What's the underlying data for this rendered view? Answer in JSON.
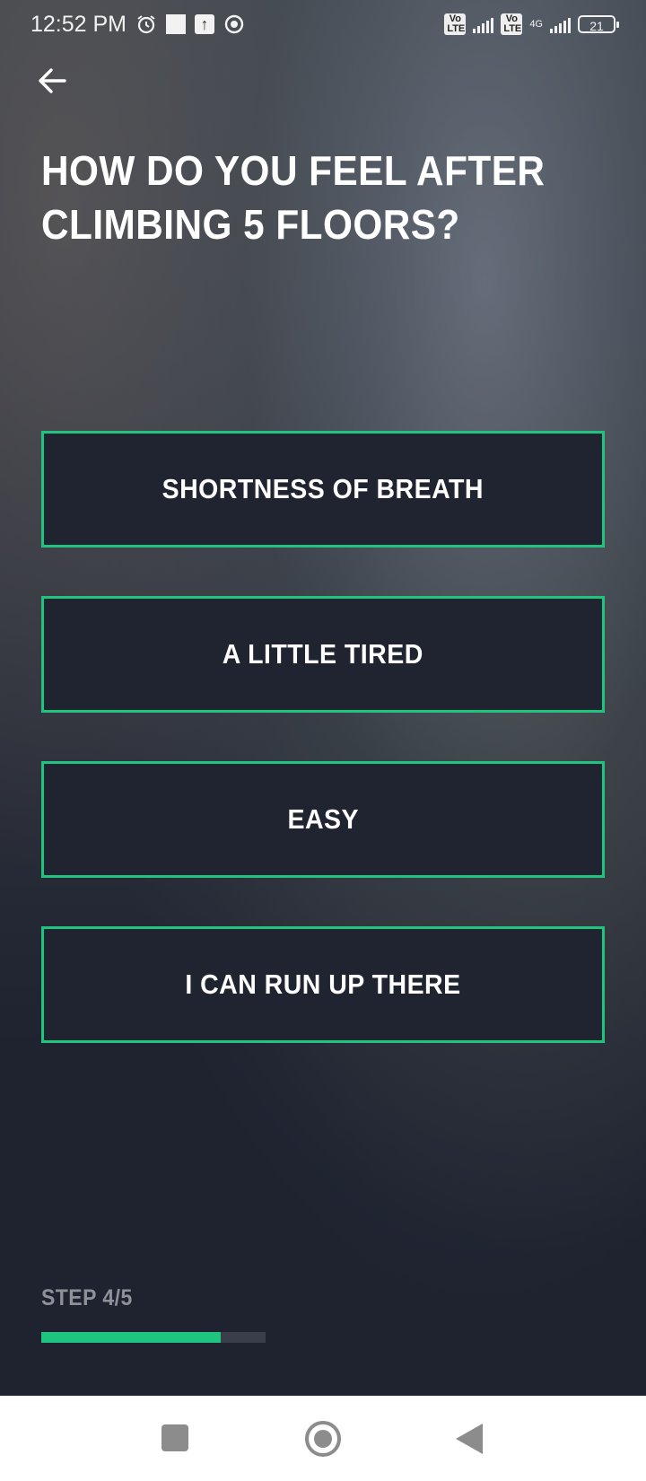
{
  "status_bar": {
    "time": "12:52 PM",
    "battery": "21",
    "network_4g": "4G",
    "volte1": "Vo LTE",
    "volte2": "Vo LTE"
  },
  "question": {
    "title": "HOW DO YOU FEEL AFTER CLIMBING 5 FLOORS?"
  },
  "options": [
    {
      "label": "SHORTNESS OF BREATH"
    },
    {
      "label": "A LITTLE TIRED"
    },
    {
      "label": "EASY"
    },
    {
      "label": "I CAN RUN UP THERE"
    }
  ],
  "progress": {
    "step_label": "STEP 4/5",
    "fraction": 0.8
  },
  "colors": {
    "accent": "#1fc47e",
    "background": "#1f2330",
    "option_bg": "#202431"
  },
  "nav": {
    "icons": [
      "recents-square-icon",
      "home-circle-icon",
      "back-triangle-icon"
    ]
  }
}
